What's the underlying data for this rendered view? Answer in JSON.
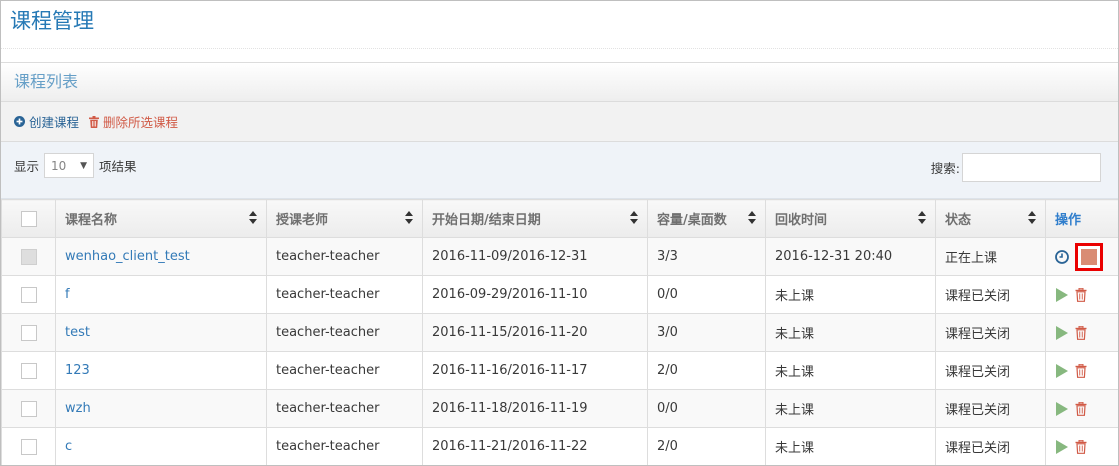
{
  "header": {
    "title": "课程管理"
  },
  "widget": {
    "title": "课程列表"
  },
  "toolbar": {
    "create_label": "创建课程",
    "delete_label": "删除所选课程"
  },
  "controls": {
    "show_label": "显示",
    "page_length": "10",
    "results_label": "项结果",
    "search_label": "搜索:",
    "search_value": ""
  },
  "table": {
    "columns": [
      "课程名称",
      "授课老师",
      "开始日期/结束日期",
      "容量/桌面数",
      "回收时间",
      "状态",
      "操作"
    ],
    "rows": [
      {
        "name": "wenhao_client_test",
        "teacher": "teacher-teacher",
        "dates": "2016-11-09/2016-12-31",
        "capacity": "3/3",
        "recycle": "2016-12-31 20:40",
        "status": "正在上课",
        "actions": [
          "clock-icon",
          "stop-icon"
        ]
      },
      {
        "name": "f",
        "teacher": "teacher-teacher",
        "dates": "2016-09-29/2016-11-10",
        "capacity": "0/0",
        "recycle": "未上课",
        "status": "课程已关闭",
        "actions": [
          "play-icon",
          "trash-icon"
        ]
      },
      {
        "name": "test",
        "teacher": "teacher-teacher",
        "dates": "2016-11-15/2016-11-20",
        "capacity": "3/0",
        "recycle": "未上课",
        "status": "课程已关闭",
        "actions": [
          "play-icon",
          "trash-icon"
        ]
      },
      {
        "name": "123",
        "teacher": "teacher-teacher",
        "dates": "2016-11-16/2016-11-17",
        "capacity": "2/0",
        "recycle": "未上课",
        "status": "课程已关闭",
        "actions": [
          "play-icon",
          "trash-icon"
        ]
      },
      {
        "name": "wzh",
        "teacher": "teacher-teacher",
        "dates": "2016-11-18/2016-11-19",
        "capacity": "0/0",
        "recycle": "未上课",
        "status": "课程已关闭",
        "actions": [
          "play-icon",
          "trash-icon"
        ]
      },
      {
        "name": "c",
        "teacher": "teacher-teacher",
        "dates": "2016-11-21/2016-11-22",
        "capacity": "2/0",
        "recycle": "未上课",
        "status": "课程已关闭",
        "actions": [
          "play-icon",
          "trash-icon"
        ]
      }
    ]
  },
  "colors": {
    "title": "#2679b5",
    "link": "#337ab7",
    "play": "#87b87f",
    "delete": "#d15b47",
    "stop_highlight": "#ea0000"
  }
}
